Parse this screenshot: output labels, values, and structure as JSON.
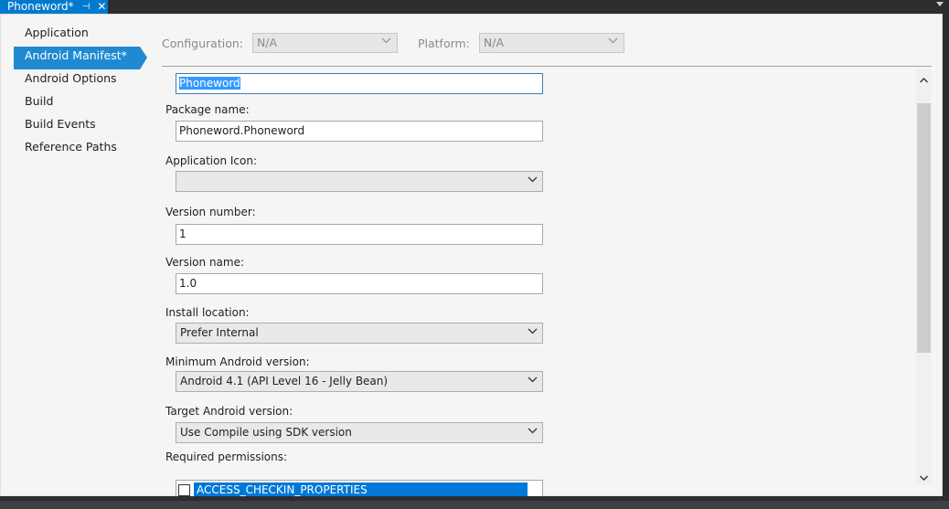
{
  "tab": {
    "title": "Phoneword*",
    "pin_glyph": "⊣",
    "close_glyph": "✕"
  },
  "nav": {
    "items": [
      {
        "label": "Application",
        "active": false
      },
      {
        "label": "Android Manifest*",
        "active": true
      },
      {
        "label": "Android Options",
        "active": false
      },
      {
        "label": "Build",
        "active": false
      },
      {
        "label": "Build Events",
        "active": false
      },
      {
        "label": "Reference Paths",
        "active": false
      }
    ]
  },
  "config": {
    "configuration_label": "Configuration:",
    "configuration_value": "N/A",
    "platform_label": "Platform:",
    "platform_value": "N/A"
  },
  "form": {
    "app_name_value": "Phoneword",
    "package_label": "Package name:",
    "package_value": "Phoneword.Phoneword",
    "icon_label": "Application Icon:",
    "icon_value": "",
    "version_number_label": "Version number:",
    "version_number_value": "1",
    "version_name_label": "Version name:",
    "version_name_value": "1.0",
    "install_location_label": "Install location:",
    "install_location_value": "Prefer Internal",
    "min_android_label": "Minimum Android version:",
    "min_android_value": "Android 4.1 (API Level 16 - Jelly Bean)",
    "target_android_label": "Target Android version:",
    "target_android_value": "Use Compile using SDK version",
    "permissions_label": "Required permissions:",
    "permissions": [
      {
        "name": "ACCESS_CHECKIN_PROPERTIES",
        "checked": false,
        "selected": true
      }
    ]
  },
  "colors": {
    "accent": "#007acc",
    "selection": "#0078d7",
    "chrome": "#2d2d30"
  }
}
